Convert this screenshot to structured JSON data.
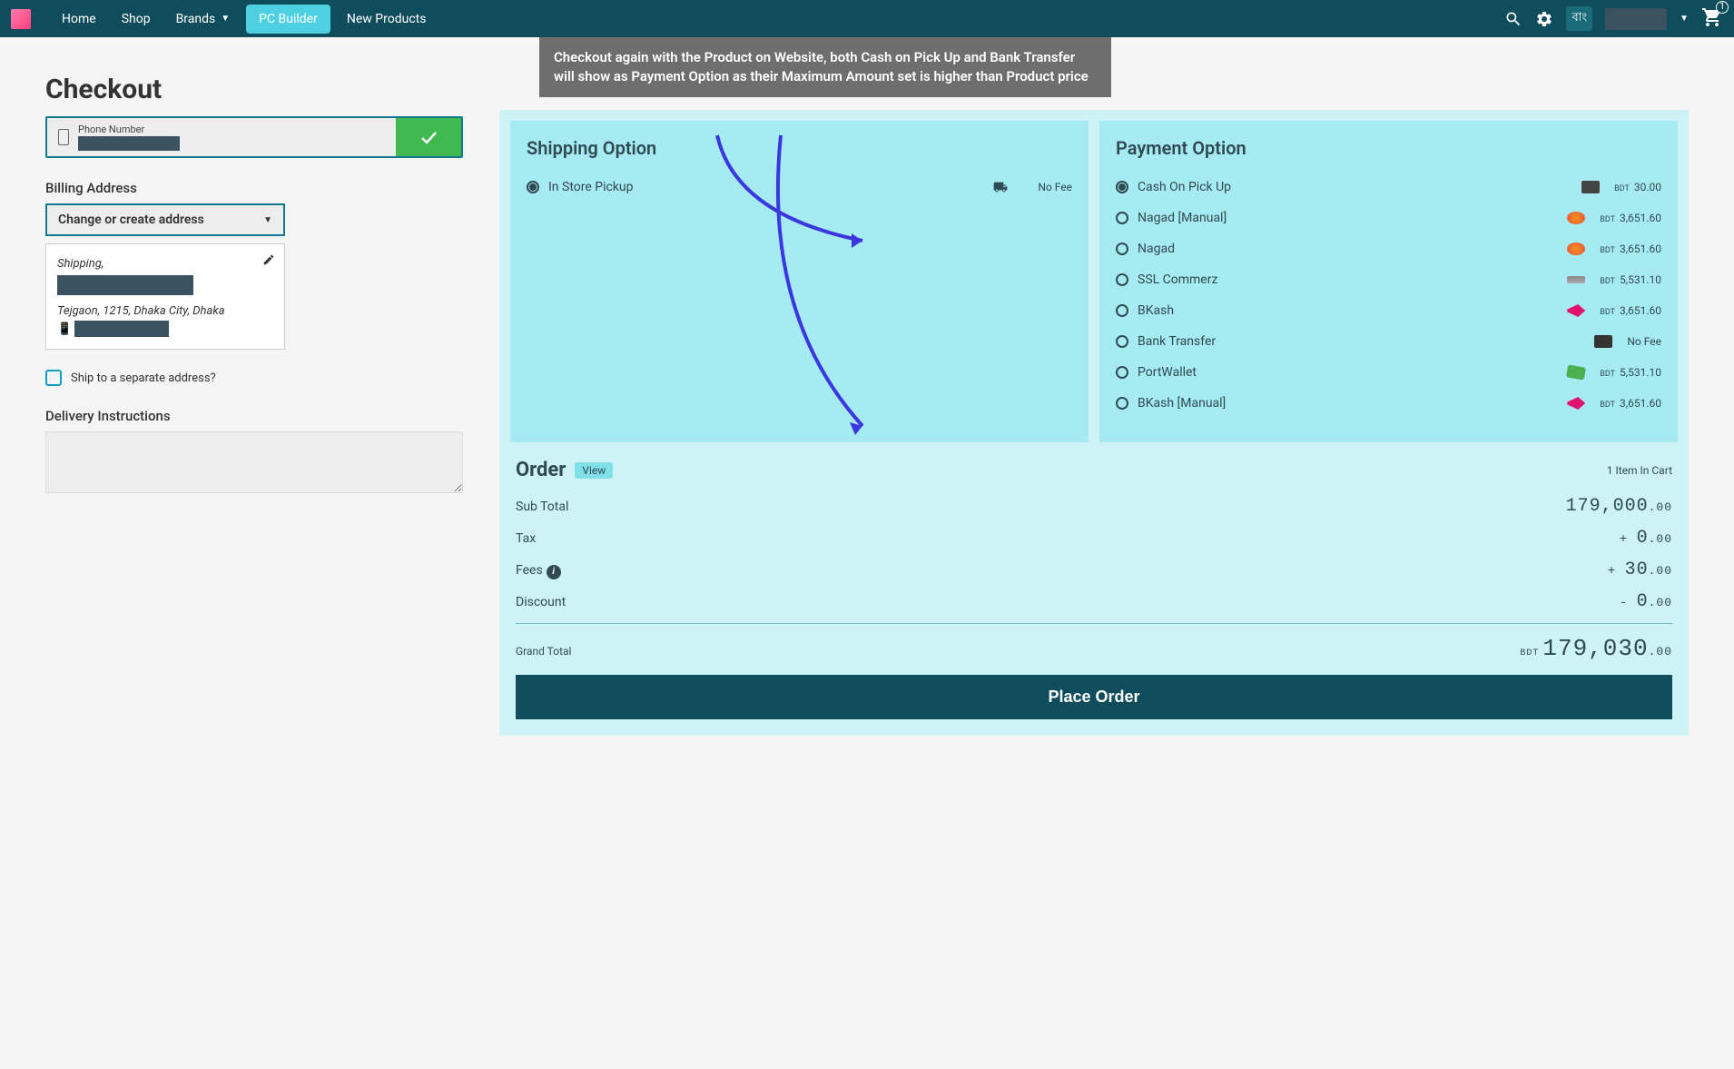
{
  "nav": {
    "links": [
      "Home",
      "Shop",
      "Brands",
      "PC Builder",
      "New Products"
    ],
    "lang": "বাং",
    "cart_count": "1"
  },
  "annotation": "Checkout again with the Product on Website, both Cash on Pick Up and Bank Transfer will show as Payment Option as their Maximum Amount set is higher than Product price",
  "checkout": {
    "title": "Checkout",
    "phone_label": "Phone Number",
    "billing_label": "Billing Address",
    "change_address": "Change or create address",
    "address": {
      "line1": "Shipping,",
      "line2": "Tejgaon, 1215, Dhaka City, Dhaka"
    },
    "ship_separate": "Ship to a separate address?",
    "delivery_instructions": "Delivery Instructions"
  },
  "shipping": {
    "title": "Shipping Option",
    "items": [
      {
        "label": "In Store Pickup",
        "fee": "No Fee",
        "selected": true
      }
    ]
  },
  "payment": {
    "title": "Payment Option",
    "currency": "BDT",
    "items": [
      {
        "label": "Cash On Pick Up",
        "fee": "30.00",
        "selected": true,
        "icon": "wallet"
      },
      {
        "label": "Nagad [Manual]",
        "fee": "3,651.60",
        "selected": false,
        "icon": "nagad"
      },
      {
        "label": "Nagad",
        "fee": "3,651.60",
        "selected": false,
        "icon": "nagad"
      },
      {
        "label": "SSL Commerz",
        "fee": "5,531.10",
        "selected": false,
        "icon": "ssl"
      },
      {
        "label": "BKash",
        "fee": "3,651.60",
        "selected": false,
        "icon": "bkash"
      },
      {
        "label": "Bank Transfer",
        "fee": "No Fee",
        "selected": false,
        "icon": "bank",
        "nofee": true
      },
      {
        "label": "PortWallet",
        "fee": "5,531.10",
        "selected": false,
        "icon": "port"
      },
      {
        "label": "BKash [Manual]",
        "fee": "3,651.60",
        "selected": false,
        "icon": "bkash"
      }
    ]
  },
  "order": {
    "title": "Order",
    "view": "View",
    "count": "1 Item In Cart",
    "rows": {
      "subtotal_label": "Sub Total",
      "subtotal_int": "179,000",
      "subtotal_dec": ".00",
      "tax_label": "Tax",
      "tax_int": "0",
      "tax_dec": ".00",
      "tax_sign": "+ ",
      "fees_label": "Fees",
      "fees_int": "30",
      "fees_dec": ".00",
      "fees_sign": "+ ",
      "discount_label": "Discount",
      "discount_int": "0",
      "discount_dec": ".00",
      "discount_sign": "- ",
      "grand_label": "Grand Total",
      "grand_cur": "BDT",
      "grand_int": "179,030",
      "grand_dec": ".00"
    },
    "place": "Place Order"
  }
}
